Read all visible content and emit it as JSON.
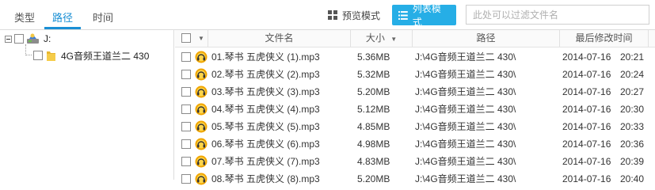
{
  "tabs": [
    {
      "label": "类型",
      "active": false
    },
    {
      "label": "路径",
      "active": true
    },
    {
      "label": "时间",
      "active": false
    }
  ],
  "modes": {
    "preview_label": "预览模式",
    "list_label": "列表模式"
  },
  "filter": {
    "placeholder": "此处可以过滤文件名",
    "value": ""
  },
  "tree": {
    "root_label": "J:",
    "child_label": "4G音频王道兰二 430"
  },
  "columns": {
    "name": "文件名",
    "size": "大小",
    "path": "路径",
    "modified": "最后修改时间"
  },
  "files": [
    {
      "name": "01.琴书 五虎侠义 (1).mp3",
      "size": "5.36MB",
      "path": "J:\\4G音频王道兰二 430\\",
      "date": "2014-07-16",
      "time": "20:21"
    },
    {
      "name": "02.琴书 五虎侠义 (2).mp3",
      "size": "5.32MB",
      "path": "J:\\4G音频王道兰二 430\\",
      "date": "2014-07-16",
      "time": "20:24"
    },
    {
      "name": "03.琴书 五虎侠义 (3).mp3",
      "size": "5.20MB",
      "path": "J:\\4G音频王道兰二 430\\",
      "date": "2014-07-16",
      "time": "20:27"
    },
    {
      "name": "04.琴书 五虎侠义 (4).mp3",
      "size": "5.12MB",
      "path": "J:\\4G音频王道兰二 430\\",
      "date": "2014-07-16",
      "time": "20:30"
    },
    {
      "name": "05.琴书 五虎侠义 (5).mp3",
      "size": "4.85MB",
      "path": "J:\\4G音频王道兰二 430\\",
      "date": "2014-07-16",
      "time": "20:33"
    },
    {
      "name": "06.琴书 五虎侠义 (6).mp3",
      "size": "4.98MB",
      "path": "J:\\4G音频王道兰二 430\\",
      "date": "2014-07-16",
      "time": "20:36"
    },
    {
      "name": "07.琴书 五虎侠义 (7).mp3",
      "size": "4.83MB",
      "path": "J:\\4G音频王道兰二 430\\",
      "date": "2014-07-16",
      "time": "20:39"
    },
    {
      "name": "08.琴书 五虎侠义 (8).mp3",
      "size": "5.20MB",
      "path": "J:\\4G音频王道兰二 430\\",
      "date": "2014-07-16",
      "time": "20:40"
    }
  ],
  "colors": {
    "accent": "#26aee6",
    "tab_active": "#1a8fd4"
  },
  "icons": {
    "preview_mode": "grid-icon",
    "list_mode": "list-icon",
    "drive": "drive-icon",
    "folder": "folder-icon",
    "file": "mp3-file-icon"
  }
}
